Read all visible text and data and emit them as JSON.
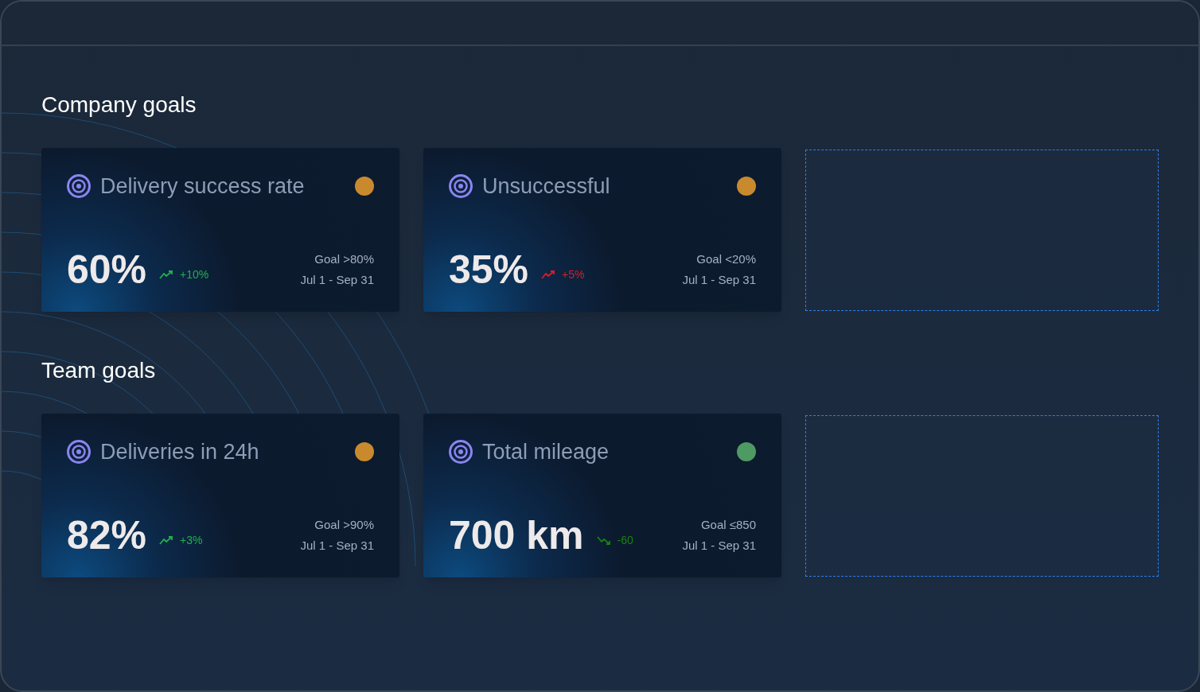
{
  "sections": [
    {
      "title": "Company goals",
      "cards": [
        {
          "kind": "goal",
          "title": "Delivery success rate",
          "color": "#c98a2e",
          "value": "60%",
          "trend": {
            "kind": "up",
            "color": "#22b14c",
            "text": "+10%"
          },
          "goal": "Goal >80%",
          "period": "Jul 1 - Sep 31"
        },
        {
          "kind": "goal",
          "title": "Unsuccessful",
          "color": "#c98a2e",
          "value": "35%",
          "trend": {
            "kind": "up",
            "color": "#e01b24",
            "text": "+5%"
          },
          "goal": "Goal <20%",
          "period": "Jul 1 - Sep 31"
        },
        {
          "kind": "empty"
        }
      ]
    },
    {
      "title": "Team goals",
      "cards": [
        {
          "kind": "goal",
          "title": "Deliveries in 24h",
          "color": "#c98a2e",
          "value": "82%",
          "trend": {
            "kind": "up",
            "color": "#22b14c",
            "text": "+3%"
          },
          "goal": "Goal >90%",
          "period": "Jul 1 - Sep 31"
        },
        {
          "kind": "goal",
          "title": "Total mileage",
          "color": "#4e9a63",
          "value": "700 km",
          "trend": {
            "kind": "down",
            "color": "#14850f",
            "text": "-60"
          },
          "goal": "Goal ≤850",
          "period": "Jul 1 - Sep 31"
        },
        {
          "kind": "empty"
        }
      ]
    }
  ]
}
